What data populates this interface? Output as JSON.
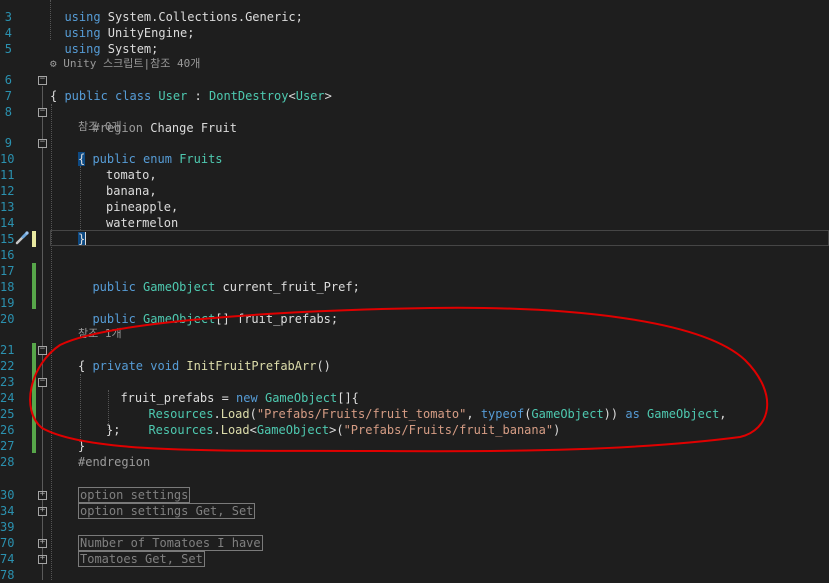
{
  "editor": {
    "line_numbers": [
      "3",
      "4",
      "5",
      "6",
      "7",
      "8",
      "9",
      "10",
      "11",
      "12",
      "13",
      "14",
      "15",
      "16",
      "17",
      "18",
      "19",
      "20",
      "21",
      "22",
      "23",
      "24",
      "25",
      "26",
      "27",
      "28",
      "30",
      "34",
      "39",
      "70",
      "74",
      "78"
    ],
    "lines": {
      "l2": [
        "using System.Collections.Generic;"
      ],
      "l3": [
        "using UnityEngine;"
      ],
      "l4": [
        "using System;"
      ],
      "lens_unity": "⚙ Unity 스크립트|참조 40개",
      "l6": [
        "public",
        " ",
        "class",
        " ",
        "User",
        " : ",
        "DontDestroy",
        "<",
        "User",
        ">"
      ],
      "l7": [
        "{"
      ],
      "l8": [
        "#region ",
        "Change Fruit"
      ],
      "lens_ref0": "참조 0개",
      "l9": [
        "public",
        " ",
        "enum",
        " ",
        "Fruits"
      ],
      "l10": [
        "{"
      ],
      "l11": [
        "tomato,"
      ],
      "l12": [
        "banana,"
      ],
      "l13": [
        "pineapple,"
      ],
      "l14": [
        "watermelon"
      ],
      "l15": [
        "}"
      ],
      "l17": [
        "public",
        " ",
        "GameObject",
        " current_fruit_Pref;"
      ],
      "l19": [
        "public",
        " ",
        "GameObject",
        "[] fruit_prefabs;"
      ],
      "lens_ref1": "참조 1개",
      "l21": [
        "private",
        " ",
        "void",
        " ",
        "InitFruitPrefabArr",
        "()"
      ],
      "l22": [
        "{"
      ],
      "l23": [
        "fruit_prefabs = ",
        "new",
        " ",
        "GameObject",
        "[]{"
      ],
      "l24": [
        "Resources",
        ".",
        "Load",
        "(",
        "\"Prefabs/Fruits/fruit_tomato\"",
        ", ",
        "typeof",
        "(",
        "GameObject",
        ")) ",
        "as",
        " ",
        "GameObject",
        ","
      ],
      "l25": [
        "Resources",
        ".",
        "Load",
        "<",
        "GameObject",
        ">(",
        "\"Prefabs/Fruits/fruit_banana\"",
        ")"
      ],
      "l26": [
        "};"
      ],
      "l27": [
        "}"
      ],
      "l28": [
        "#endregion"
      ],
      "region_option_settings": "option settings",
      "region_option_getset": "option settings Get, Set",
      "region_tomatoes": "Number of Tomatoes I have",
      "region_tomatoes_getset": "Tomatoes Get, Set"
    }
  },
  "colors": {
    "background": "#1e1e1e",
    "keyword": "#569cd6",
    "type": "#4ec9b0",
    "string": "#d69d85",
    "method": "#dcdcaa",
    "line_number": "#2b91af",
    "change_bar": "#57a64a",
    "annotation": "#e00000"
  },
  "icons": {
    "quick_action": "screwdriver-brush-icon",
    "fold_expanded": "minus-box-icon",
    "fold_collapsed": "plus-box-icon"
  }
}
